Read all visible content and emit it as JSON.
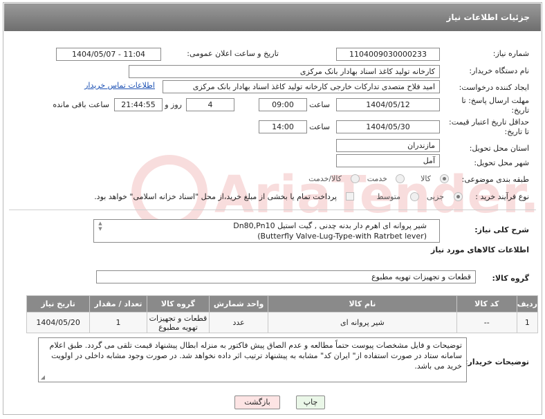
{
  "header": {
    "title": "جزئیات اطلاعات نیاز"
  },
  "form": {
    "need_number": {
      "label": "شماره نیاز:",
      "value": "1104009030000233"
    },
    "announce": {
      "label": "تاریخ و ساعت اعلان عمومی:",
      "value": "1404/05/07 - 11:04"
    },
    "buyer_org": {
      "label": "نام دستگاه خریدار:",
      "value": "کارخانه تولید کاغذ اسناد بهادار بانک مرکزی"
    },
    "requester": {
      "label": "ایجاد کننده درخواست:",
      "value": "امید فلاح متصدی تدارکات خارجی کارخانه تولید کاغذ اسناد بهادار بانک مرکزی",
      "link": "اطلاعات تماس خریدار"
    },
    "deadline": {
      "label_line1": "مهلت ارسال پاسخ: تا",
      "label_line2": "تاریخ:",
      "date": "1404/05/12",
      "time_label": "ساعت",
      "time": "09:00",
      "days": "4",
      "days_label": "روز و",
      "remaining": "21:44:55",
      "remaining_label": "ساعت باقی مانده"
    },
    "validity": {
      "label_line1": "حداقل تاریخ اعتبار قیمت:",
      "label_line2": "تا تاریخ:",
      "date": "1404/05/30",
      "time_label": "ساعت",
      "time": "14:00"
    },
    "province": {
      "label": "استان محل تحویل:",
      "value": "مازندران"
    },
    "city": {
      "label": "شهر محل تحویل:",
      "value": "آمل"
    },
    "category": {
      "label": "طبقه بندی موضوعی:",
      "options": [
        "کالا",
        "خدمت",
        "کالا/خدمت"
      ],
      "selected": "کالا"
    },
    "process": {
      "label": "نوع فرآیند خرید :",
      "options": [
        "جزیی",
        "متوسط"
      ],
      "selected": "جزیی",
      "note": "پرداخت تمام یا بخشی از مبلغ خرید،از محل \"اسناد خزانه اسلامی\" خواهد بود."
    }
  },
  "description": {
    "label": "شرح کلی نیاز:",
    "line1": "شیر پروانه ای اهرم دار بدنه چدنی , گیت استیل Dn80,Pn10",
    "line2": "(Butterfly Valve-Lug-Type-with Ratrbet lever)"
  },
  "goods": {
    "section_title": "اطلاعات کالاهای مورد نیاز",
    "group_label": "گروه کالا:",
    "group_value": "قطعات و تجهیزات تهویه مطبوع",
    "columns": [
      "ردیف",
      "کد کالا",
      "نام کالا",
      "واحد شمارش",
      "گروه کالا",
      "تعداد / مقدار",
      "تاریخ نیاز"
    ],
    "rows": [
      {
        "index": "1",
        "code": "--",
        "name": "شیر پروانه ای",
        "unit": "عدد",
        "group": "قطعات و تجهیزات تهویه مطبوع",
        "qty": "1",
        "date": "1404/05/20"
      }
    ]
  },
  "buyer_notes": {
    "label": "توضیحات خریدار:",
    "text": "توضیحات و فایل مشخصات پیوست حتماً مطالعه و عدم الصاق پیش فاکتور به منزله ابطال پیشنهاد قیمت تلقی می گردد. طبق اعلام سامانه ستاد در صورت استفاده از\" ایران کد\" مشابه به پیشنهاد ترتیب اثر داده نخواهد شد. در صورت وجود مشابه داخلی در اولویت خرید می باشد."
  },
  "buttons": {
    "print": "چاپ",
    "back": "بازگشت"
  },
  "watermark": {
    "text": "AriaTender.neT"
  },
  "colors": {
    "titlebar": "#7c7c7c",
    "link": "#1a4fb3",
    "back_button": "#fde4e4",
    "print_button": "#eaf7e8"
  }
}
